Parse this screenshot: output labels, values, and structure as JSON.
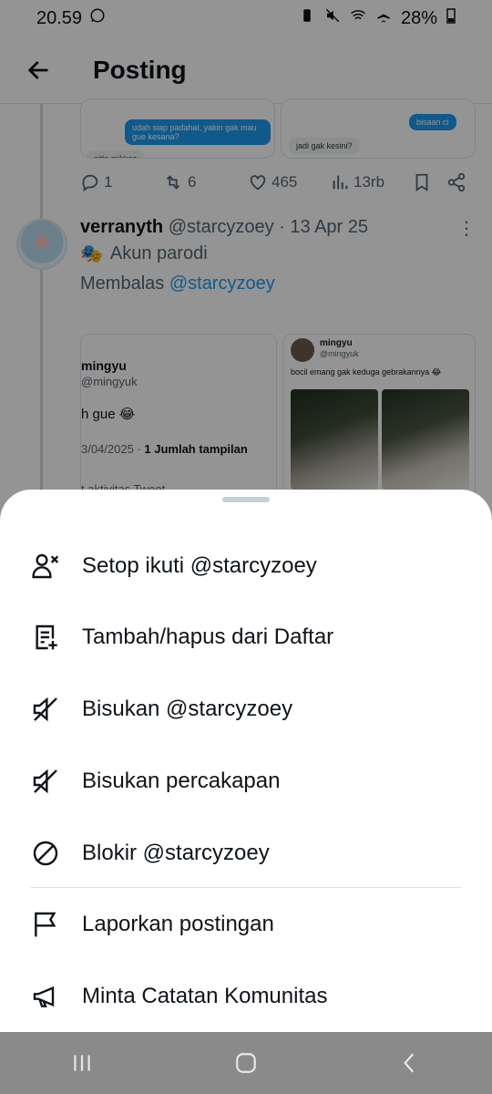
{
  "status": {
    "time": "20.59",
    "battery": "28%"
  },
  "header": {
    "title": "Posting"
  },
  "prev_tweet": {
    "chat_left": "udah siap padahal, yakin gak mau gue kesana?",
    "chat_left2": "nitip mikkea",
    "chat_right_blue": "bisaan ci",
    "chat_right_gray": "jadi gak kesini?",
    "replies": "1",
    "reposts": "6",
    "likes": "465",
    "views": "13rb"
  },
  "tweet": {
    "name": "verranyth",
    "handle": "@starcyzoey · 13 Apr 25",
    "parody": "Akun parodi",
    "reply_prefix": "Membalas",
    "reply_mention": "@starcyzoey",
    "quote_left": {
      "name": "mingyu",
      "handle": "@mingyuk",
      "text": "h gue 😂",
      "meta_date": "3/04/2025 · ",
      "meta_views": "1 Jumlah tampilan",
      "footer": "t aktivitas Tweet"
    },
    "quote_right": {
      "name": "mingyu",
      "handle": "@mingyuk",
      "text": "bocil emang gak keduga gebrakannya 😂"
    }
  },
  "menu": {
    "items": [
      {
        "label": "Setop ikuti @starcyzoey",
        "icon": "unfollow-icon"
      },
      {
        "label": "Tambah/hapus dari Daftar",
        "icon": "list-add-icon"
      },
      {
        "label": "Bisukan @starcyzoey",
        "icon": "mute-icon"
      },
      {
        "label": "Bisukan percakapan",
        "icon": "mute-icon"
      },
      {
        "label": "Blokir @starcyzoey",
        "icon": "block-icon"
      },
      {
        "label": "Laporkan postingan",
        "icon": "flag-icon"
      },
      {
        "label": "Minta Catatan Komunitas",
        "icon": "megaphone-icon"
      }
    ]
  },
  "colors": {
    "accent": "#1d9bf0",
    "text": "#0f1419",
    "secondary": "#536471",
    "scrim": "rgba(0,0,0,0.42)",
    "navbar": "#8a8a8a"
  }
}
